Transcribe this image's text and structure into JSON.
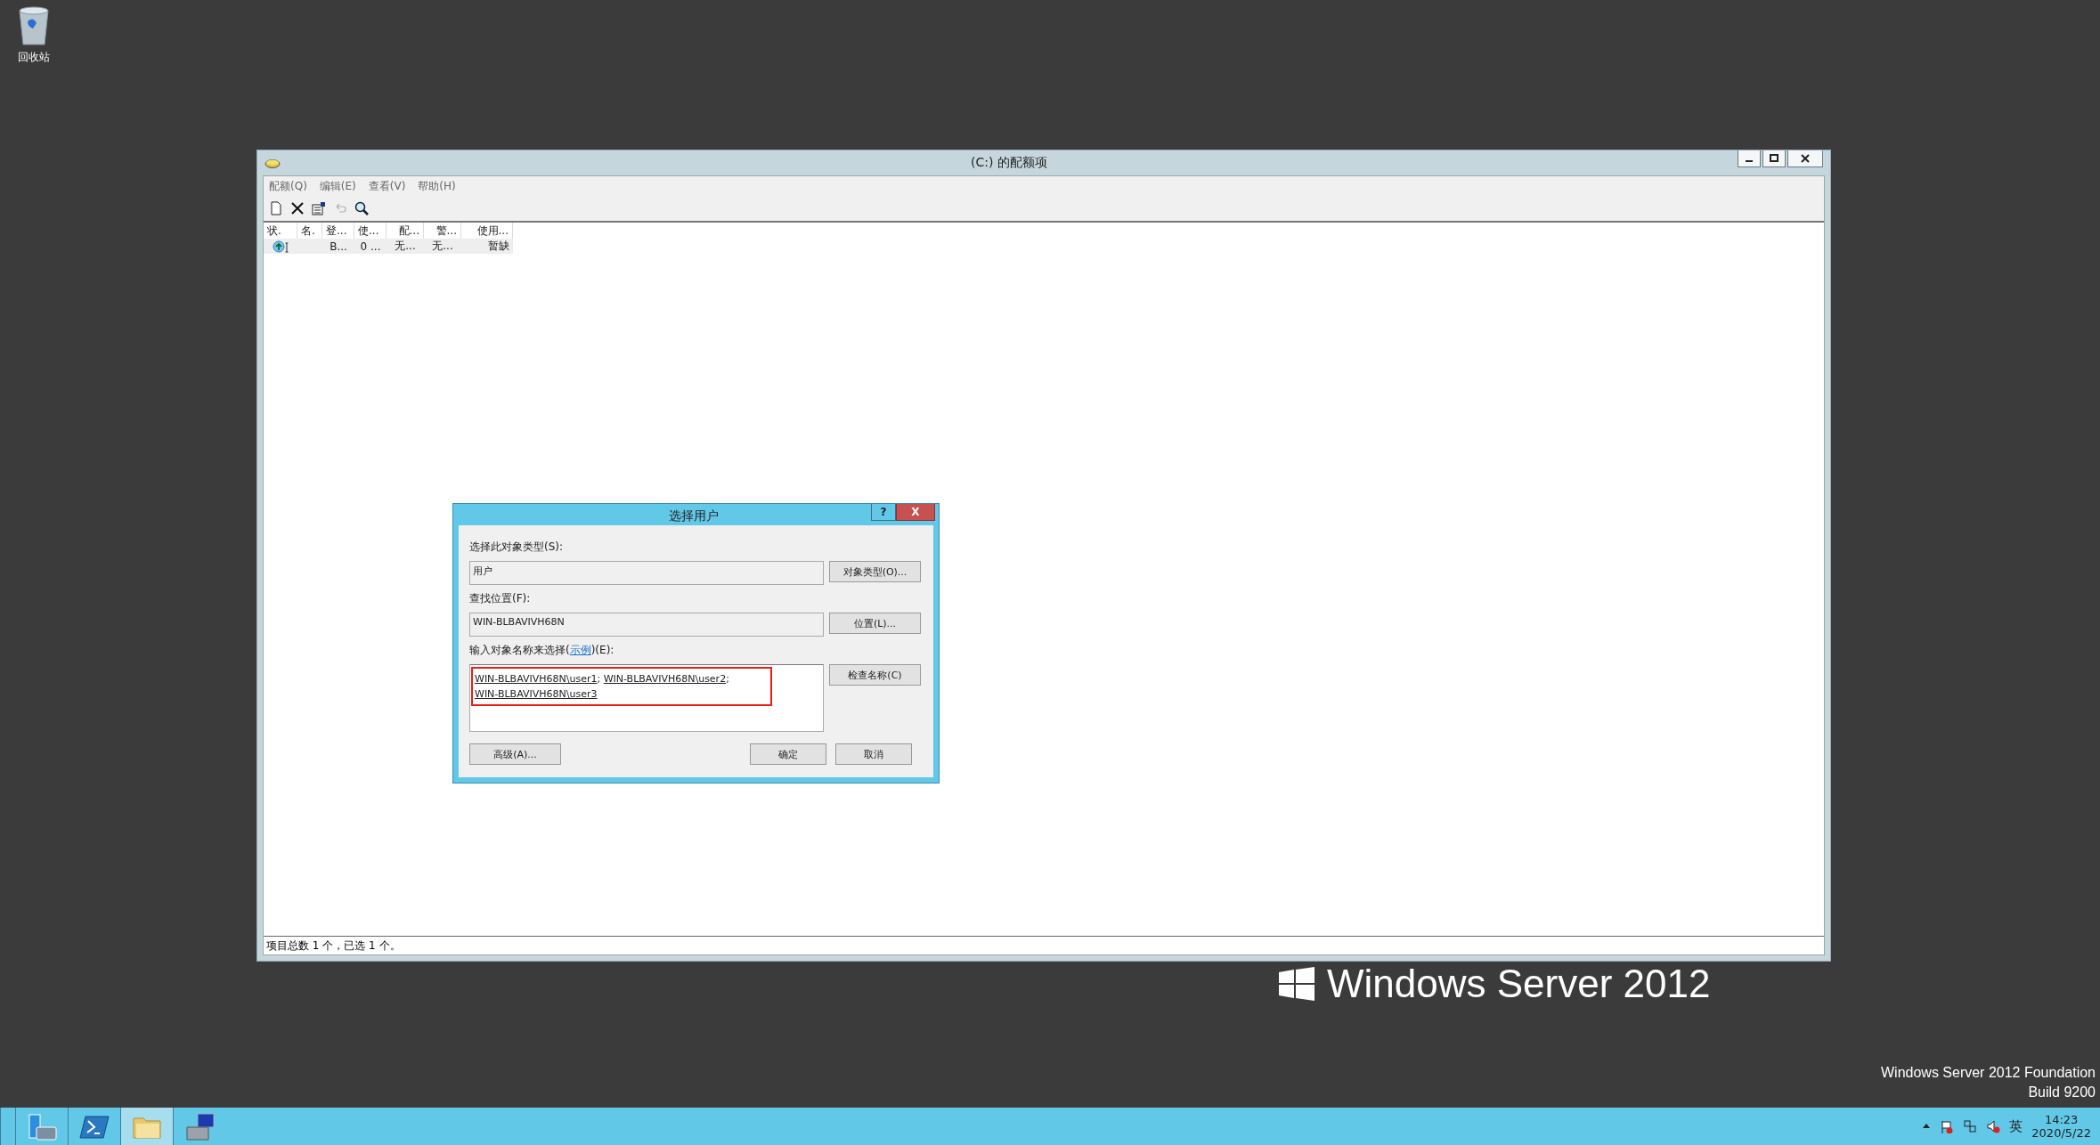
{
  "desktop": {
    "icons": [
      {
        "label": "回收站"
      }
    ],
    "logo_text": "Windows Server 2012",
    "edition": "Windows Server 2012 Foundation",
    "build": "Build 9200"
  },
  "window": {
    "title": "(C:) 的配额项",
    "menu": [
      "配额(Q)",
      "编辑(E)",
      "查看(V)",
      "帮助(H)"
    ],
    "toolbar": [
      {
        "kind": "new",
        "disabled": false
      },
      {
        "kind": "delete",
        "disabled": false
      },
      {
        "kind": "properties",
        "disabled": false
      },
      {
        "kind": "undo",
        "disabled": true
      },
      {
        "kind": "find",
        "disabled": false
      }
    ],
    "table": {
      "columns": [
        "状.",
        "名.",
        "登...",
        "使...",
        "配...",
        "警...",
        "使用..."
      ],
      "rows": [
        {
          "selected": true,
          "cells": [
            "",
            "",
            "B...",
            "0 ...",
            "无...",
            "无...",
            "暂缺"
          ]
        }
      ]
    },
    "status_bar": "项目总数 1 个，已选 1 个。"
  },
  "dialog": {
    "title": "选择用户",
    "help": "?",
    "close": "X",
    "type_label": "选择此对象类型(S):",
    "type_value": "用户",
    "type_button": "对象类型(O)...",
    "location_label": "查找位置(F):",
    "location_value": "WIN-BLBAVIVH68N",
    "location_button": "位置(L)...",
    "names_label_before": "输入对象名称来选择(",
    "names_link": "示例",
    "names_label_after": ")(E):",
    "names": [
      "WIN-BLBAVIVH68N\\user1",
      "WIN-BLBAVIVH68N\\user2",
      "WIN-BLBAVIVH68N\\user3"
    ],
    "separator": ";",
    "highlighted": true,
    "check_button": "检查名称(C)",
    "advanced_button": "高级(A)...",
    "ok_button": "确定",
    "cancel_button": "取消"
  },
  "taskbar": {
    "items": [
      {
        "kind": "server",
        "selected": false
      },
      {
        "kind": "shell",
        "selected": false
      },
      {
        "kind": "folder",
        "selected": true
      },
      {
        "kind": "tools",
        "selected": false
      }
    ],
    "tray": [
      {
        "kind": "arrow"
      },
      {
        "kind": "flag"
      },
      {
        "kind": "network"
      },
      {
        "kind": "volume"
      }
    ],
    "ime": "英",
    "time": "14:23",
    "date": "2020/5/22"
  }
}
